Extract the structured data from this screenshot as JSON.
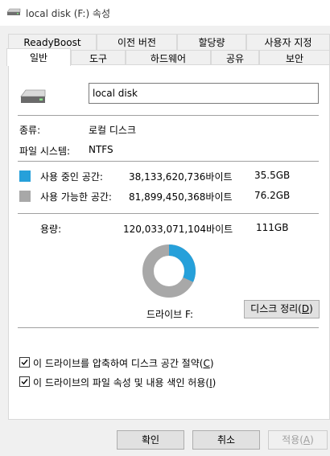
{
  "window": {
    "title": "local disk (F:) 속성"
  },
  "tabs_row1": [
    "ReadyBoost",
    "이전 버전",
    "할당량",
    "사용자 지정"
  ],
  "tabs_row2": [
    "일반",
    "도구",
    "하드웨어",
    "공유",
    "보안"
  ],
  "general": {
    "drive_name": "local disk",
    "type_label": "종류:",
    "type_value": "로컬 디스크",
    "fs_label": "파일 시스템:",
    "fs_value": "NTFS",
    "used": {
      "label": "사용 중인 공간:",
      "bytes": "38,133,620,736바이트",
      "size": "35.5GB",
      "color": "#26a0da"
    },
    "free": {
      "label": "사용 가능한 공간:",
      "bytes": "81,899,450,368바이트",
      "size": "76.2GB",
      "color": "#a8a8a8"
    },
    "capacity": {
      "label": "용량:",
      "bytes": "120,033,071,104바이트",
      "size": "111GB"
    },
    "used_fraction": 0.318,
    "drive_label": "드라이브 F:",
    "cleanup": {
      "text": "디스크 정리(",
      "key": "D",
      "close": ")"
    }
  },
  "options": {
    "compress": {
      "text": "이 드라이브를 압축하여 디스크 공간 절약(",
      "key": "C",
      "close": ")",
      "checked": true
    },
    "index": {
      "text": "이 드라이브의 파일 속성 및 내용 색인 허용(",
      "key": "I",
      "close": ")",
      "checked": true
    }
  },
  "footer": {
    "ok": "확인",
    "cancel": "취소",
    "apply": {
      "text": "적용(",
      "key": "A",
      "close": ")"
    }
  }
}
